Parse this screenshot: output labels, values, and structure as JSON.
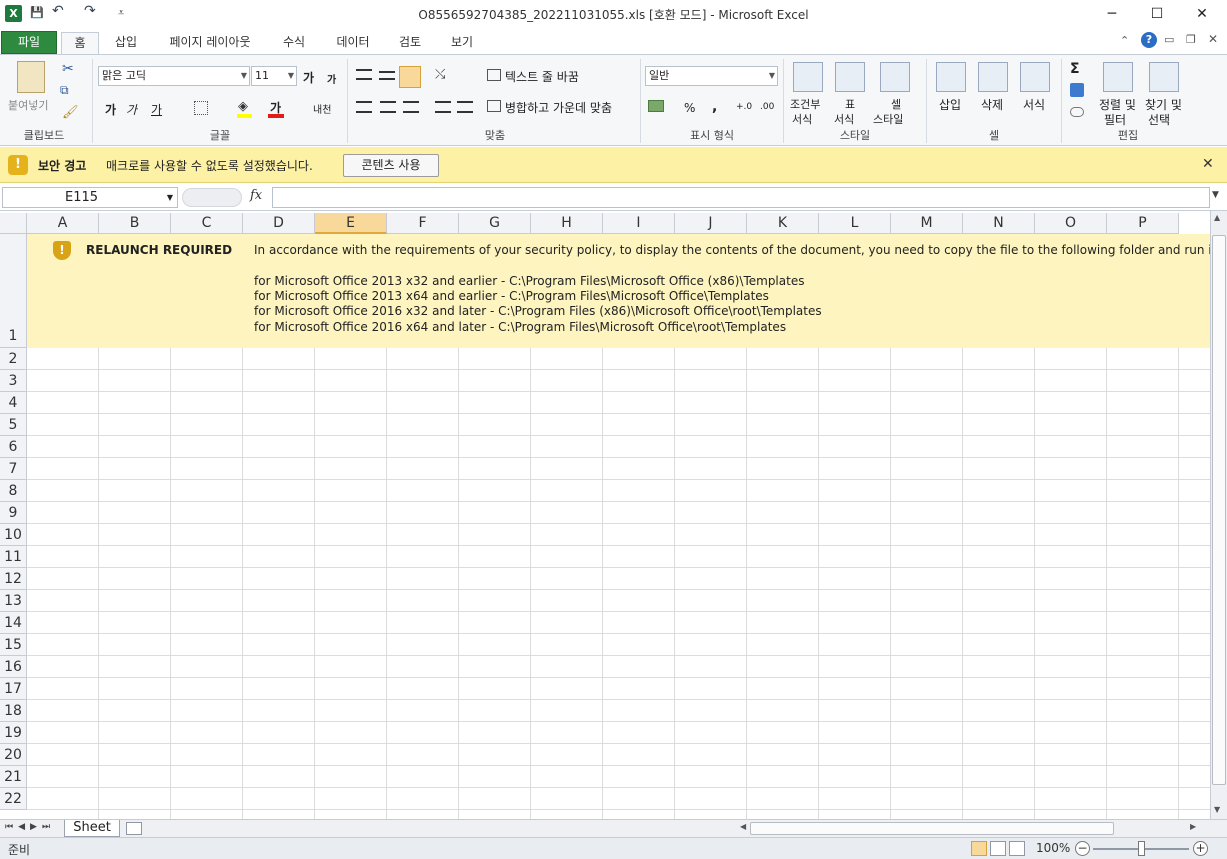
{
  "window": {
    "title": "O8556592704385_202211031055.xls  [호환 모드]  -  Microsoft Excel",
    "minimize": "─",
    "maximize": "☐",
    "close": "✕"
  },
  "qat": {
    "save": "💾",
    "undo": "↶",
    "redo": "↷",
    "customize": "⩡"
  },
  "tabs": {
    "file": "파일",
    "home": "홈",
    "insert": "삽입",
    "page_layout": "페이지 레이아웃",
    "formulas": "수식",
    "data": "데이터",
    "review": "검토",
    "view": "보기"
  },
  "ribbon": {
    "clipboard": {
      "label": "클립보드",
      "paste": "붙여넣기"
    },
    "font": {
      "label": "글꼴",
      "font_name": "맑은 고딕",
      "font_size": "11",
      "grow": "가",
      "shrink": "가",
      "bold": "가",
      "italic": "가",
      "underline": "가",
      "asian_layout": "내천"
    },
    "alignment": {
      "label": "맞춤",
      "wrap_text": "텍스트 줄 바꿈",
      "merge_center": "병합하고 가운데 맞춤"
    },
    "number": {
      "label": "표시 형식",
      "format": "일반",
      "percent": "%",
      "comma": ","
    },
    "styles": {
      "label": "스타일",
      "conditional_1": "조건부",
      "conditional_2": "서식",
      "table_1": "표",
      "table_2": "서식",
      "cell_1": "셀",
      "cell_2": "스타일"
    },
    "cells": {
      "label": "셀",
      "insert": "삽입",
      "delete": "삭제",
      "format": "서식"
    },
    "editing": {
      "label": "편집",
      "sum": "Σ",
      "sort_1": "정렬 및",
      "sort_2": "필터",
      "find_1": "찾기 및",
      "find_2": "선택"
    }
  },
  "security_bar": {
    "title": "보안 경고",
    "message": "매크로를 사용할 수 없도록 설정했습니다.",
    "enable_button": "콘텐츠 사용",
    "close": "✕"
  },
  "formula_bar": {
    "name_box": "E115",
    "fx": "fx",
    "value": ""
  },
  "columns": [
    "A",
    "B",
    "C",
    "D",
    "E",
    "F",
    "G",
    "H",
    "I",
    "J",
    "K",
    "L",
    "M",
    "N",
    "O",
    "P"
  ],
  "selected_column": "E",
  "rows": [
    "1",
    "2",
    "3",
    "4",
    "5",
    "6",
    "7",
    "8",
    "9",
    "10",
    "11",
    "12",
    "13",
    "14",
    "15",
    "16",
    "17",
    "18",
    "19",
    "20",
    "21",
    "22"
  ],
  "banner": {
    "icon": "!",
    "title": "RELAUNCH REQUIRED",
    "message": "In accordance with the requirements of your security policy, to display the contents of the document, you need to copy the file to the following folder and run it again:",
    "paths": [
      "for Microsoft Office 2013 x32 and earlier - C:\\Program Files\\Microsoft Office (x86)\\Templates",
      "for Microsoft Office 2013 x64 and earlier - C:\\Program Files\\Microsoft Office\\Templates",
      "for Microsoft Office 2016 x32 and later - C:\\Program Files (x86)\\Microsoft Office\\root\\Templates",
      "for Microsoft Office 2016 x64 and later - C:\\Program Files\\Microsoft Office\\root\\Templates"
    ]
  },
  "sheet_tabs": {
    "active": "Sheet"
  },
  "status": {
    "ready": "준비",
    "zoom": "100%"
  }
}
